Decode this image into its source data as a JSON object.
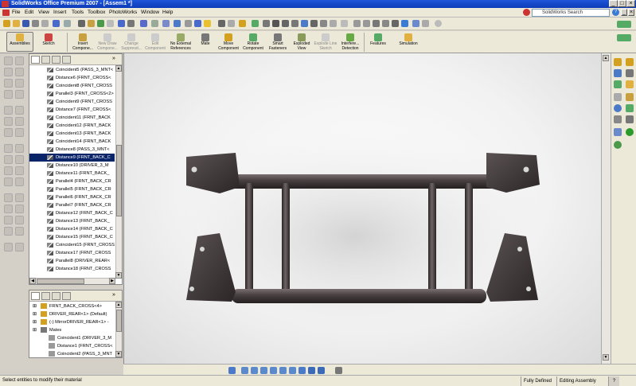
{
  "window": {
    "title": "SolidWorks Office Premium 2007 - [Assem1 *]"
  },
  "menu": [
    "File",
    "Edit",
    "View",
    "Insert",
    "Tools",
    "Toolbox",
    "PhotoWorks",
    "Window",
    "Help"
  ],
  "search": {
    "placeholder": "SolidWorks Search"
  },
  "command_manager": [
    {
      "label": "Assemblies",
      "enabled": true
    },
    {
      "label": "Sketch",
      "enabled": true
    },
    {
      "label": "Insert Compone...",
      "enabled": true
    },
    {
      "label": "New Draw Compone...",
      "enabled": false
    },
    {
      "label": "Change Suppresd...",
      "enabled": false
    },
    {
      "label": "Edit Component",
      "enabled": false
    },
    {
      "label": "No External References",
      "enabled": true
    },
    {
      "label": "Mate",
      "enabled": true
    },
    {
      "label": "Move Component",
      "enabled": true
    },
    {
      "label": "Rotate Component",
      "enabled": true
    },
    {
      "label": "Smart Fasteners",
      "enabled": true
    },
    {
      "label": "Exploded View",
      "enabled": true
    },
    {
      "label": "Explode Line Sketch",
      "enabled": false
    },
    {
      "label": "Interfere... Detection",
      "enabled": true
    },
    {
      "label": "Features",
      "enabled": true
    },
    {
      "label": "Simulation",
      "enabled": true
    }
  ],
  "feature_tree_top": [
    {
      "label": "Coincident5 (PASS_3_MNT<",
      "selected": false
    },
    {
      "label": "Distance6 (FRNT_CROSS<",
      "selected": false
    },
    {
      "label": "Coincident8 (FRNT_CROSS",
      "selected": false
    },
    {
      "label": "Parallel3 (FRNT_CROSS<2>",
      "selected": false
    },
    {
      "label": "Coincident9 (FRNT_CROSS",
      "selected": false
    },
    {
      "label": "Distance7 (FRNT_CROSS<",
      "selected": false
    },
    {
      "label": "Coincident11 (FRNT_BACK",
      "selected": false
    },
    {
      "label": "Coincident12 (FRNT_BACK",
      "selected": false
    },
    {
      "label": "Coincident13 (FRNT_BACK",
      "selected": false
    },
    {
      "label": "Coincident14 (FRNT_BACK",
      "selected": false
    },
    {
      "label": "Distance8 (PASS_3_MNT<",
      "selected": false
    },
    {
      "label": "Distance9 (FRNT_BACK_C",
      "selected": true
    },
    {
      "label": "Distance10 (DRIVER_3_M",
      "selected": false
    },
    {
      "label": "Distance11 (FRNT_BACK_",
      "selected": false
    },
    {
      "label": "Parallel4 (FRNT_BACK_CR",
      "selected": false
    },
    {
      "label": "Parallel5 (FRNT_BACK_CR",
      "selected": false
    },
    {
      "label": "Parallel6 (FRNT_BACK_CR",
      "selected": false
    },
    {
      "label": "Parallel7 (FRNT_BACK_CR",
      "selected": false
    },
    {
      "label": "Distance12 (FRNT_BACK_C",
      "selected": false
    },
    {
      "label": "Distance13 (FRNT_BACK_",
      "selected": false
    },
    {
      "label": "Distance14 (FRNT_BACK_C",
      "selected": false
    },
    {
      "label": "Distance15 (FRNT_BACK_C",
      "selected": false
    },
    {
      "label": "Coincident15 (FRNT_CROSS",
      "selected": false
    },
    {
      "label": "Distance17 (FRNT_CROSS",
      "selected": false
    },
    {
      "label": "Parallel8 (DRIVER_REAR<",
      "selected": false
    },
    {
      "label": "Distance18 (FRNT_CROSS",
      "selected": false
    }
  ],
  "feature_tree_bottom": [
    {
      "label": "FRNT_BACK_CROSS<4>",
      "kind": "part"
    },
    {
      "label": "DRIVER_REAR<1> (Default)",
      "kind": "part"
    },
    {
      "label": "(-) MirrorDRIVER_REAR<1> -",
      "kind": "part"
    },
    {
      "label": "Mates",
      "kind": "folder"
    },
    {
      "label": "Coincident1 (DRIVER_3_M",
      "kind": "mate"
    },
    {
      "label": "Distance1 (FRNT_CROSS<",
      "kind": "mate"
    },
    {
      "label": "Coincident2 (PASS_3_MNT",
      "kind": "mate"
    }
  ],
  "status": {
    "message": "Select entities to modify their material",
    "state": "Fully Defined",
    "mode": "Editing Assembly"
  },
  "colors": {
    "accent": "#0a246a",
    "model": "#3a3334",
    "title": "#1f55d8"
  }
}
